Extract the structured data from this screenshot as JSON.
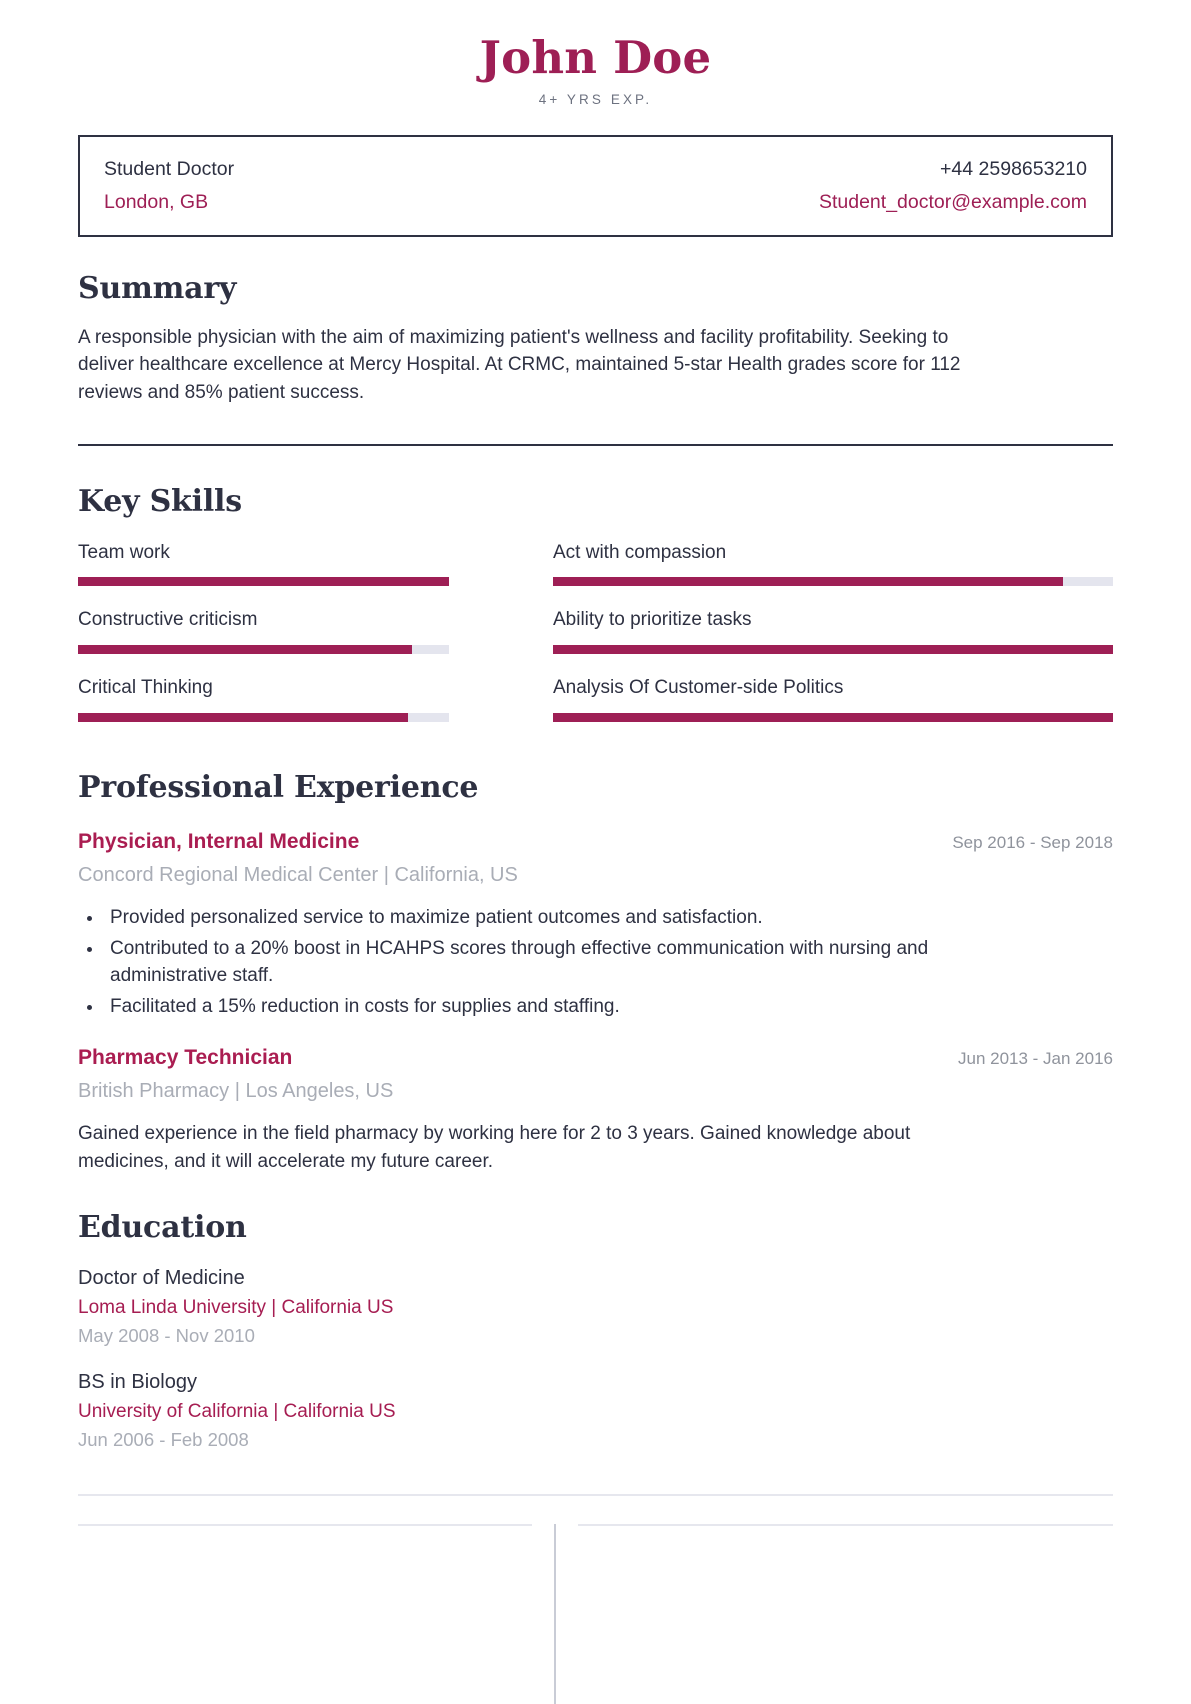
{
  "header": {
    "name": "John Doe",
    "subtitle": "4+ YRS EXP."
  },
  "contact": {
    "title": "Student Doctor",
    "location": "London, GB",
    "phone": "+44 2598653210",
    "email": "Student_doctor@example.com"
  },
  "summary": {
    "title": "Summary",
    "text": "A responsible physician with the aim of maximizing patient's wellness and facility profitability. Seeking to deliver healthcare excellence at Mercy Hospital. At CRMC, maintained 5-star Health grades score for 112 reviews and 85% patient success."
  },
  "skills": {
    "title": "Key Skills",
    "items": [
      {
        "label": "Team work",
        "percent": 100
      },
      {
        "label": "Act with compassion",
        "percent": 91
      },
      {
        "label": "Constructive criticism",
        "percent": 90
      },
      {
        "label": "Ability to prioritize tasks",
        "percent": 100
      },
      {
        "label": "Critical Thinking",
        "percent": 89
      },
      {
        "label": "Analysis Of Customer-side Politics",
        "percent": 100
      }
    ]
  },
  "experience": {
    "title": "Professional Experience",
    "items": [
      {
        "role": "Physician, Internal Medicine",
        "dates": "Sep 2016 - Sep 2018",
        "org": "Concord Regional Medical Center | California, US",
        "bullets": [
          " Provided personalized service to maximize patient outcomes and satisfaction.",
          "Contributed to a 20% boost in HCAHPS scores through effective communication with nursing and administrative staff.",
          "Facilitated a 15% reduction in costs for supplies and staffing."
        ],
        "paragraph": ""
      },
      {
        "role": "Pharmacy Technician",
        "dates": "Jun 2013 - Jan 2016",
        "org": "British Pharmacy | Los Angeles, US",
        "bullets": [],
        "paragraph": "Gained experience in the field pharmacy by working here for 2 to 3  years. Gained knowledge about medicines, and it will accelerate my future career."
      }
    ]
  },
  "education": {
    "title": "Education",
    "items": [
      {
        "degree": "Doctor of Medicine",
        "school": "Loma Linda University | California US",
        "dates": "May 2008 - Nov 2010"
      },
      {
        "degree": "BS in Biology",
        "school": "University of California | California US",
        "dates": "Jun 2006 - Feb 2008"
      }
    ]
  },
  "colors": {
    "accent": "#9e1f55",
    "heading": "#2e3142",
    "muted": "#a9adb6",
    "track": "#e4e5ee"
  }
}
